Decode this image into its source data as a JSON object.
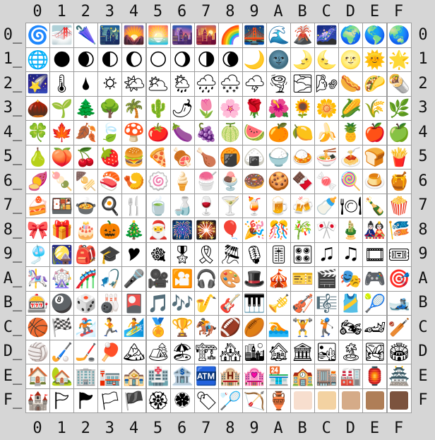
{
  "col_headers": [
    "0",
    "1",
    "2",
    "3",
    "4",
    "5",
    "6",
    "7",
    "8",
    "9",
    "A",
    "B",
    "C",
    "D",
    "E",
    "F"
  ],
  "row_headers": [
    "0_",
    "1_",
    "2_",
    "3_",
    "4_",
    "5_",
    "6_",
    "7_",
    "8_",
    "9_",
    "A_",
    "B_",
    "C_",
    "D_",
    "E_",
    "F_"
  ],
  "row_suffix_right": [
    "0",
    "1",
    "2",
    "3",
    "4",
    "5",
    "6",
    "7",
    "8",
    "9",
    "A",
    "B",
    "C",
    "D",
    "E",
    "F"
  ],
  "cells": [
    [
      "🌀",
      "🌁",
      "🌂",
      "🌃",
      "🌄",
      "🌅",
      "🌆",
      "🌇",
      "🌈",
      "🌉",
      "🌊",
      "🌋",
      "🌌",
      "🌍",
      "🌎",
      "🌏"
    ],
    [
      "🌐",
      "🌑",
      "🌒",
      "🌓",
      "🌔",
      "🌕",
      "🌖",
      "🌗",
      "🌘",
      "🌙",
      "🌚",
      "🌛",
      "🌜",
      "🌝",
      "🌞",
      "🌟"
    ],
    [
      "🌠",
      "🌡",
      "🌢",
      "🌣",
      "🌤",
      "🌥",
      "🌦",
      "🌧",
      "🌨",
      "🌩",
      "🌪",
      "🌫",
      "🌬",
      "🌭",
      "🌮",
      "🌯"
    ],
    [
      "🌰",
      "🌱",
      "🌲",
      "🌳",
      "🌴",
      "🌵",
      "🌶",
      "🌷",
      "🌸",
      "🌹",
      "🌺",
      "🌻",
      "🌼",
      "🌽",
      "🌾",
      "🌿"
    ],
    [
      "🍀",
      "🍁",
      "🍂",
      "🍃",
      "🍄",
      "🍅",
      "🍆",
      "🍇",
      "🍈",
      "🍉",
      "🍊",
      "🍋",
      "🍌",
      "🍍",
      "🍎",
      "🍏"
    ],
    [
      "🍐",
      "🍑",
      "🍒",
      "🍓",
      "🍔",
      "🍕",
      "🍖",
      "🍗",
      "🍘",
      "🍙",
      "🍚",
      "🍛",
      "🍜",
      "🍝",
      "🍞",
      "🍟"
    ],
    [
      "🍠",
      "🍡",
      "🍢",
      "🍣",
      "🍤",
      "🍥",
      "🍦",
      "🍧",
      "🍨",
      "🍩",
      "🍪",
      "🍫",
      "🍬",
      "🍭",
      "🍮",
      "🍯"
    ],
    [
      "🍰",
      "🍱",
      "🍲",
      "🍳",
      "🍴",
      "🍵",
      "🍶",
      "🍷",
      "🍸",
      "🍹",
      "🍺",
      "🍻",
      "🍼",
      "🍽",
      "🍾",
      "🍿"
    ],
    [
      "🎀",
      "🎁",
      "🎂",
      "🎃",
      "🎄",
      "🎅",
      "🎆",
      "🎇",
      "🎈",
      "🎉",
      "🎊",
      "🎋",
      "🎌",
      "🎍",
      "🎎",
      "🎏"
    ],
    [
      "🎐",
      "🎑",
      "🎒",
      "🎓",
      "🎔",
      "🎕",
      "🎖",
      "🎗",
      "🎘",
      "🎙",
      "🎚",
      "🎛",
      "🎜",
      "🎝",
      "🎞",
      "🎟"
    ],
    [
      "🎠",
      "🎡",
      "🎢",
      "🎣",
      "🎤",
      "🎥",
      "🎦",
      "🎧",
      "🎨",
      "🎩",
      "🎪",
      "🎫",
      "🎬",
      "🎭",
      "🎮",
      "🎯"
    ],
    [
      "🎰",
      "🎱",
      "🎲",
      "🎳",
      "🎴",
      "🎵",
      "🎶",
      "🎷",
      "🎸",
      "🎹",
      "🎺",
      "🎻",
      "🎼",
      "🎽",
      "🎾",
      "🎿"
    ],
    [
      "🏀",
      "🏁",
      "🏂",
      "🏃",
      "🏄",
      "🏅",
      "🏆",
      "🏇",
      "🏈",
      "🏉",
      "🏊",
      "🏋",
      "🏌",
      "🏍",
      "🏎",
      "🏏"
    ],
    [
      "🏐",
      "🏑",
      "🏒",
      "🏓",
      "🏔",
      "🏕",
      "🏖",
      "🏗",
      "🏘",
      "🏙",
      "🏚",
      "🏛",
      "🏜",
      "🏝",
      "🏞",
      "🏟"
    ],
    [
      "🏠",
      "🏡",
      "🏢",
      "🏣",
      "🏤",
      "🏥",
      "🏦",
      "🏧",
      "🏨",
      "🏩",
      "🏪",
      "🏫",
      "🏬",
      "🏭",
      "🏮",
      "🏯"
    ],
    [
      "🏰",
      "🏱",
      "🏲",
      "🏳",
      "🏴",
      "🏵",
      "🏶",
      "🏷",
      "🏸",
      "🏹",
      "🏺",
      "",
      "",
      "",
      "",
      ""
    ]
  ],
  "skin_tone_swatches": [
    {
      "col": 11,
      "color": "#f7dece"
    },
    {
      "col": 12,
      "color": "#f3d2a2"
    },
    {
      "col": 13,
      "color": "#d5ab88"
    },
    {
      "col": 14,
      "color": "#af7e57"
    },
    {
      "col": 15,
      "color": "#7c533e"
    }
  ]
}
